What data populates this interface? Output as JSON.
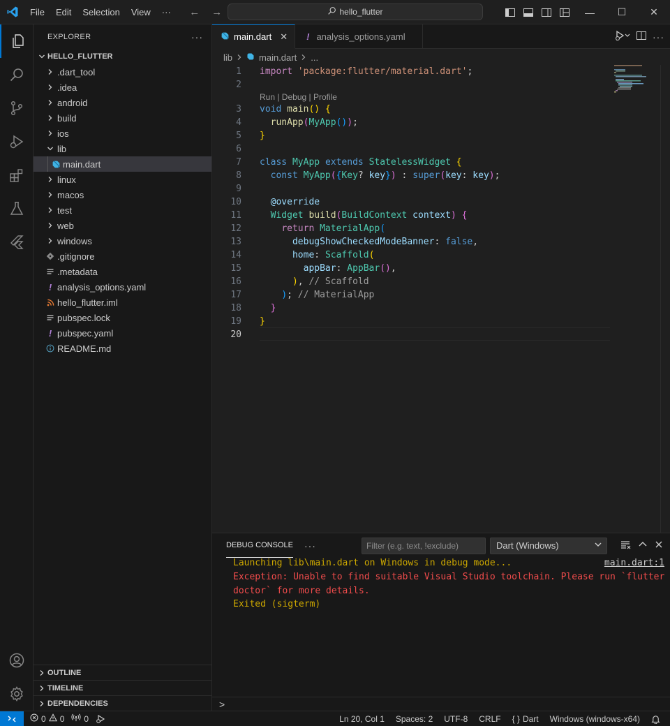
{
  "menu": [
    "File",
    "Edit",
    "Selection",
    "View",
    "···"
  ],
  "command_center": {
    "text": "hello_flutter"
  },
  "sidebar": {
    "title": "EXPLORER",
    "project": "HELLO_FLUTTER",
    "tree": [
      {
        "label": ".dart_tool",
        "type": "folder",
        "expanded": false
      },
      {
        "label": ".idea",
        "type": "folder",
        "expanded": false
      },
      {
        "label": "android",
        "type": "folder",
        "expanded": false
      },
      {
        "label": "build",
        "type": "folder",
        "expanded": false
      },
      {
        "label": "ios",
        "type": "folder",
        "expanded": false
      },
      {
        "label": "lib",
        "type": "folder",
        "expanded": true
      },
      {
        "label": "main.dart",
        "type": "dart-file",
        "selected": true
      },
      {
        "label": "linux",
        "type": "folder",
        "expanded": false
      },
      {
        "label": "macos",
        "type": "folder",
        "expanded": false
      },
      {
        "label": "test",
        "type": "folder",
        "expanded": false
      },
      {
        "label": "web",
        "type": "folder",
        "expanded": false
      },
      {
        "label": "windows",
        "type": "folder",
        "expanded": false
      },
      {
        "label": ".gitignore",
        "type": "git-file"
      },
      {
        "label": ".metadata",
        "type": "lines-file"
      },
      {
        "label": "analysis_options.yaml",
        "type": "yaml-file"
      },
      {
        "label": "hello_flutter.iml",
        "type": "rss-file"
      },
      {
        "label": "pubspec.lock",
        "type": "lines-file"
      },
      {
        "label": "pubspec.yaml",
        "type": "yaml-file"
      },
      {
        "label": "README.md",
        "type": "info-file"
      }
    ],
    "sections": [
      "OUTLINE",
      "TIMELINE",
      "DEPENDENCIES"
    ]
  },
  "tabs": [
    {
      "label": "main.dart",
      "active": true
    },
    {
      "label": "analysis_options.yaml",
      "active": false
    }
  ],
  "breadcrumb": [
    "lib",
    "main.dart",
    "..."
  ],
  "editor": {
    "codelens": "Run | Debug | Profile",
    "current_line": 20,
    "line_numbers": [
      "1",
      "2",
      "3",
      "4",
      "5",
      "6",
      "7",
      "8",
      "9",
      "10",
      "11",
      "12",
      "13",
      "14",
      "15",
      "16",
      "17",
      "18",
      "19",
      "20"
    ]
  },
  "panel": {
    "tab": "DEBUG CONSOLE",
    "filter_placeholder": "Filter (e.g. text, !exclude)",
    "dropdown": "Dart (Windows)",
    "lines": [
      {
        "text": "Launching lib\\main.dart on Windows in debug mode...",
        "color": "#cca700"
      },
      {
        "text": "Exception: Unable to find suitable Visual Studio toolchain. Please run `flutter",
        "color": "#f14c4c"
      },
      {
        "text": "doctor` for more details.",
        "color": "#f14c4c"
      },
      {
        "text": "Exited (sigterm)",
        "color": "#cca700"
      }
    ],
    "source_link": "main.dart:1",
    "prompt": ">"
  },
  "statusbar": {
    "errors": "0",
    "warnings": "0",
    "ports": "0",
    "position": "Ln 20, Col 1",
    "spaces": "Spaces: 2",
    "encoding": "UTF-8",
    "eol": "CRLF",
    "language": "Dart",
    "device": "Windows (windows-x64)"
  },
  "colors": {
    "accent": "#0078d4",
    "background": "#1f1f1f",
    "sidebar": "#181818"
  }
}
